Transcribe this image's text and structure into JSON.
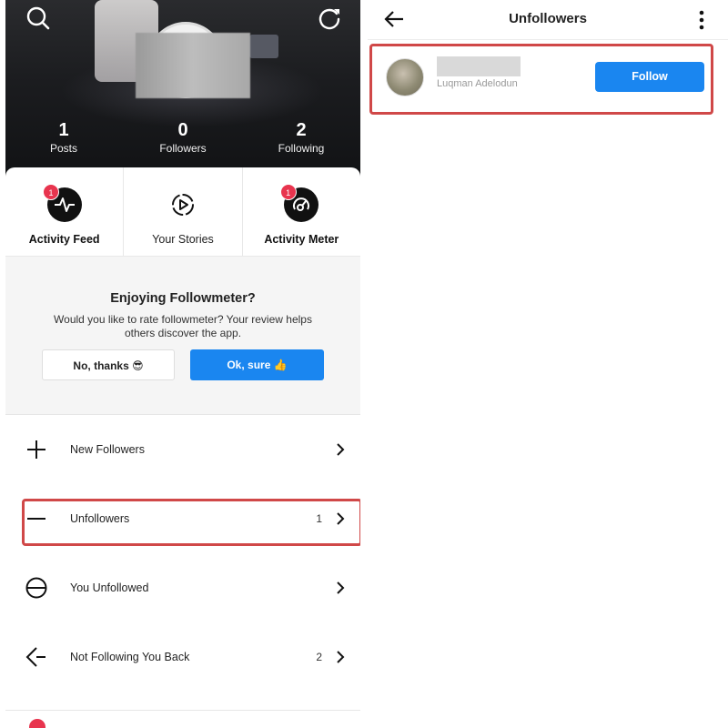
{
  "left_panel": {
    "stats": [
      {
        "value": "1",
        "label": "Posts"
      },
      {
        "value": "0",
        "label": "Followers"
      },
      {
        "value": "2",
        "label": "Following"
      }
    ],
    "features": [
      {
        "label": "Activity Feed",
        "badge": "1",
        "icon": "activity-pulse-icon"
      },
      {
        "label": "Your Stories",
        "icon": "play-circle-icon"
      },
      {
        "label": "Activity Meter",
        "badge": "1",
        "icon": "meter-icon"
      }
    ],
    "rate_prompt": {
      "title": "Enjoying Followmeter?",
      "text": "Would you like to rate followmeter? Your review helps others discover the app.",
      "no_label": "No, thanks 😎",
      "ok_label": "Ok, sure 👍"
    },
    "menu": [
      {
        "label": "New Followers",
        "count": "",
        "icon": "plus-icon"
      },
      {
        "label": "Unfollowers",
        "count": "1",
        "icon": "minus-icon"
      },
      {
        "label": "You Unfollowed",
        "count": "",
        "icon": "circle-minus-icon"
      },
      {
        "label": "Not Following You Back",
        "count": "2",
        "icon": "arrow-left-icon"
      }
    ]
  },
  "right_panel": {
    "title": "Unfollowers",
    "users": [
      {
        "handle": "Luqman Adelodun",
        "follow_label": "Follow"
      }
    ]
  },
  "colors": {
    "accent_blue": "#1a86f0",
    "badge_red": "#e8344e",
    "highlight_red": "#d04848"
  }
}
